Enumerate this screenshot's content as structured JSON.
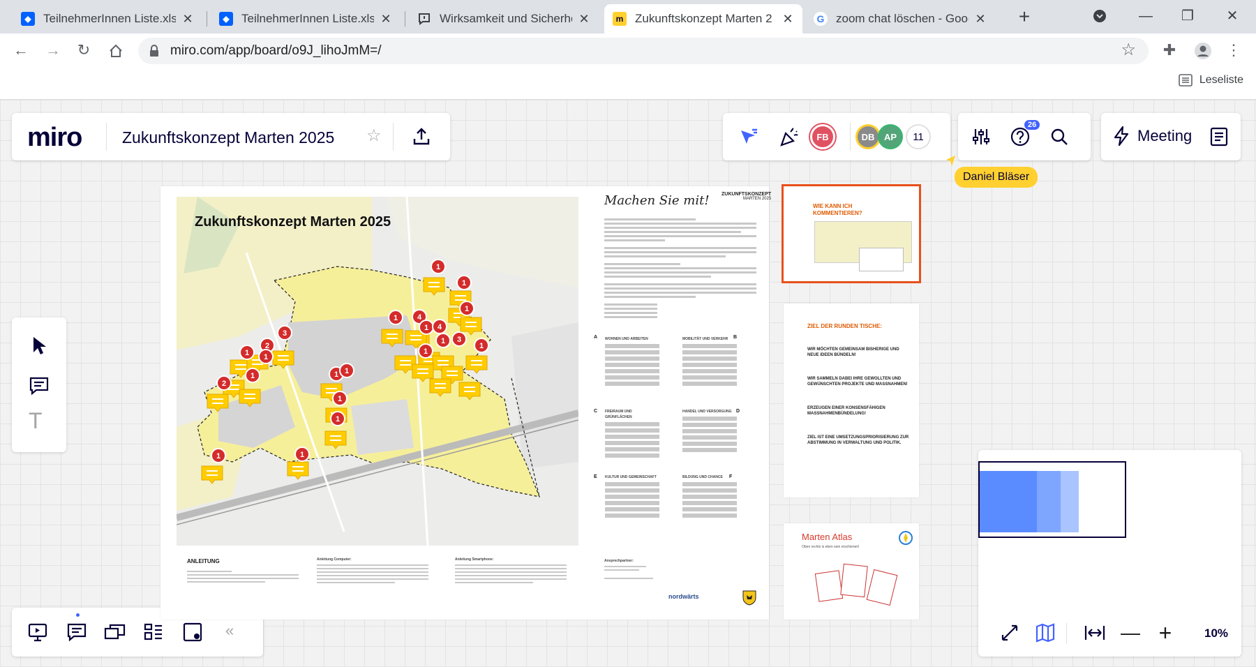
{
  "browser": {
    "tabs": [
      {
        "title": "TeilnehmerInnen Liste.xlsx",
        "icon": "dropbox-icon"
      },
      {
        "title": "TeilnehmerInnen Liste.xlsx",
        "icon": "dropbox-icon"
      },
      {
        "title": "Wirksamkeit und Sicherhe",
        "icon": "feedback-icon"
      },
      {
        "title": "Zukunftskonzept Marten 2",
        "icon": "miro-icon"
      },
      {
        "title": "zoom chat löschen - Goog",
        "icon": "google-icon"
      }
    ],
    "active_tab": 3,
    "url": "miro.com/app/board/o9J_lihoJmM=/",
    "reading_list": "Leseliste"
  },
  "miro": {
    "logo": "miro",
    "board_title": "Zukunftskonzept Marten 2025",
    "collaborators": [
      "FB",
      "DB",
      "AP"
    ],
    "collaborator_count": "11",
    "notification_count": "26",
    "meeting_label": "Meeting",
    "cursor_user": "Daniel Bläser",
    "zoom": "10%",
    "colors": {
      "accent": "#4262ff",
      "marker_yellow": "#ffcc00",
      "marker_red": "#d42b2b",
      "cursor": "#ffd02f",
      "frame_selected": "#e8501c"
    }
  },
  "board": {
    "poster": {
      "title": "Zukunftskonzept Marten 2025",
      "heading": "Machen Sie mit!",
      "brand_line1": "ZUKUNFTSKONZEPT",
      "brand_line2": "MARTEN 2025",
      "topics": [
        "WOHNEN UND ARBEITEN",
        "MOBILITÄT UND VERKEHR",
        "FREIRAUM UND GRÜNFLÄCHEN",
        "HANDEL UND VERSORGUNG",
        "KULTUR UND GEMEINSCHAFT",
        "BILDUNG UND CHANCE"
      ],
      "topic_letters": [
        "A",
        "B",
        "C",
        "D",
        "E",
        "F"
      ],
      "footer_title": "ANLEITUNG",
      "footer_col1": "Anleitung Computer:",
      "footer_col2": "Anleitung Smartphone:",
      "footer_col3": "Ansprechpartner:",
      "partner": "nordwärts",
      "map_labels": [
        "1",
        "1",
        "1",
        "1",
        "4",
        "1",
        "4",
        "3",
        "1",
        "1",
        "1",
        "1",
        "2",
        "3",
        "1",
        "1",
        "2",
        "1",
        "1",
        "1",
        "1",
        "1",
        "1"
      ]
    },
    "frame1": {
      "title_line1": "WIE KANN ICH",
      "title_line2": "KOMMENTIEREN?"
    },
    "frame2": {
      "title": "ZIEL DER RUNDEN TISCHE:",
      "lines": [
        "WIR MÖCHTEN GEMEINSAM BISHERIGE UND NEUE IDEEN BÜNDELN!",
        "WIR SAMMELN DABEI IHRE GEWOLLTEN UND GEWÜNSCHTEN PROJEKTE UND MASSNAHMEN!",
        "ERZEUGEN EINER KONSENSFÄHIGEN MASSNAHMENBÜNDELUNG!",
        "ZIEL IST EINE UMSETZUNGSPRIORISIERUNG ZUR ABSTIMMUNG IN VERWALTUNG UND POLITIK."
      ]
    },
    "frame3": {
      "title": "Marten Atlas",
      "subtitle": "Oben rechts is eben sein erschienen!"
    }
  }
}
